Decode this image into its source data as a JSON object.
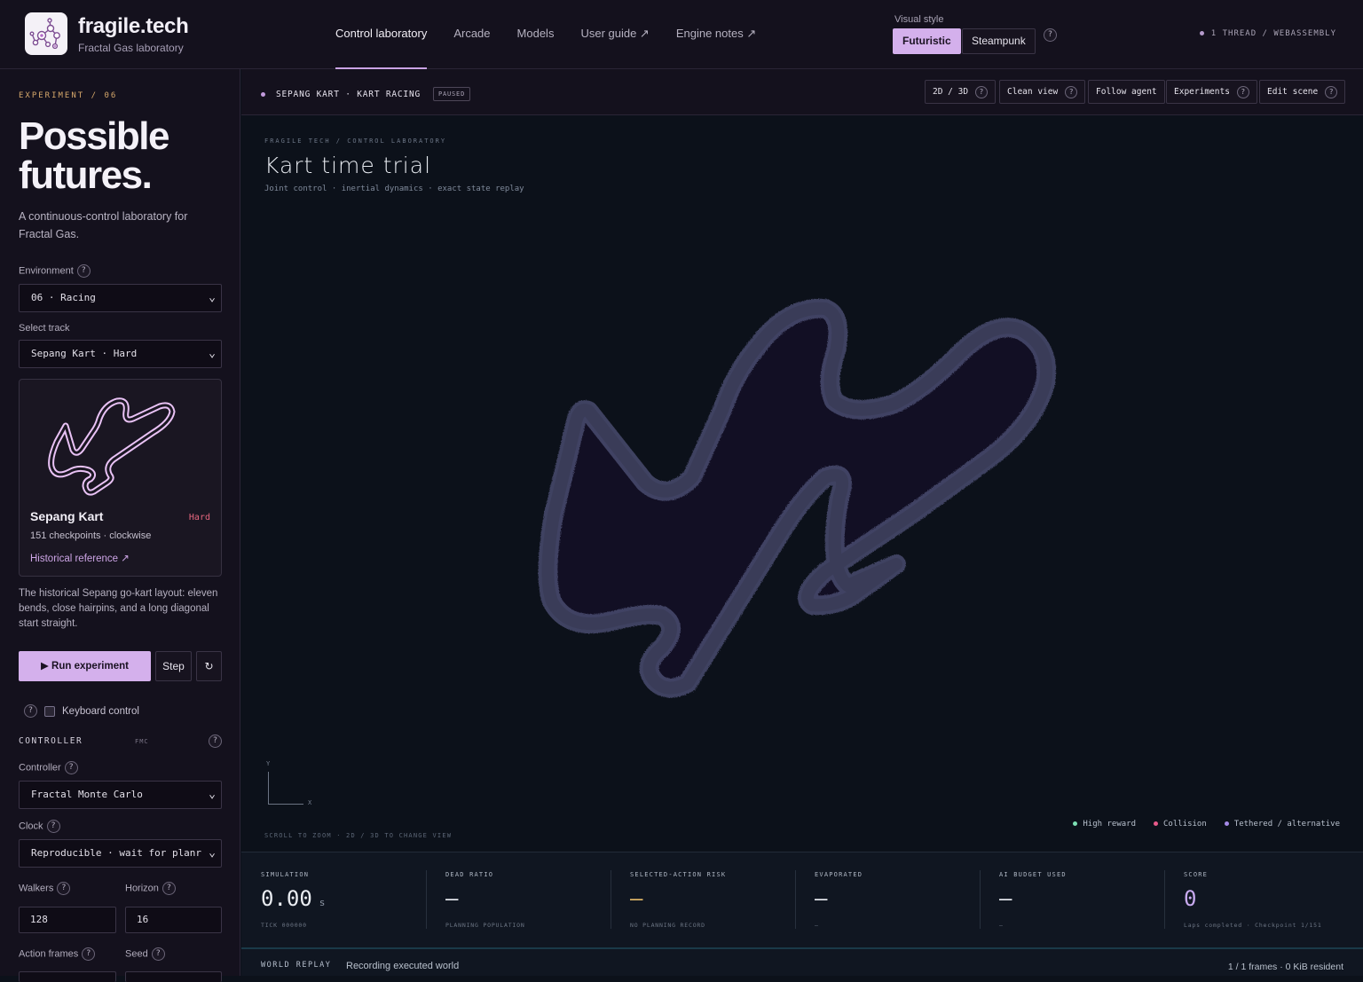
{
  "brand": {
    "title": "fragile.tech",
    "subtitle": "Fractal Gas laboratory"
  },
  "nav": [
    {
      "label": "Control laboratory",
      "active": true
    },
    {
      "label": "Arcade"
    },
    {
      "label": "Models"
    },
    {
      "label": "User guide ↗"
    },
    {
      "label": "Engine notes ↗"
    }
  ],
  "visual_style": {
    "label": "Visual style",
    "options": [
      "Futuristic",
      "Steampunk"
    ],
    "selected": "Futuristic",
    "help": "?"
  },
  "thread_info": "1 THREAD / WEBASSEMBLY",
  "sidebar": {
    "experiment_tag": "EXPERIMENT / 06",
    "hero": "Possible futures.",
    "hero_sub": "A continuous-control laboratory for Fractal Gas.",
    "environment_label": "Environment",
    "environment_value": "06 · Racing",
    "track_label": "Select track",
    "track_value": "Sepang Kart · Hard",
    "track_card": {
      "name": "Sepang Kart",
      "difficulty": "Hard",
      "meta": "151 checkpoints · clockwise",
      "link": "Historical reference ↗"
    },
    "track_description": "The historical Sepang go-kart layout: eleven bends, close hairpins, and a long diagonal start straight.",
    "run_label": "▶ Run experiment",
    "step_label": "Step",
    "reset_label": "↻",
    "keyboard_label": "Keyboard control",
    "controller_section": "CONTROLLER",
    "controller_tag": "FMC",
    "controller_label": "Controller",
    "controller_value": "Fractal Monte Carlo",
    "clock_label": "Clock",
    "clock_value": "Reproducible · wait for planr",
    "walkers_label": "Walkers",
    "walkers_value": "128",
    "horizon_label": "Horizon",
    "horizon_value": "16",
    "action_frames_label": "Action frames",
    "seed_label": "Seed",
    "help": "?"
  },
  "subbar": {
    "env_title": "SEPANG KART · KART RACING",
    "status": "PAUSED",
    "tools": [
      "2D / 3D",
      "Clean view",
      "Follow agent",
      "Experiments",
      "Edit scene"
    ],
    "help": "?"
  },
  "viewport": {
    "breadcrumb": "FRAGILE TECH / CONTROL LABORATORY",
    "title": "Kart time trial",
    "subtitle": "Joint control · inertial dynamics · exact state replay",
    "axis_x": "X",
    "axis_y": "Y",
    "hint": "SCROLL TO ZOOM · 2D / 3D TO CHANGE VIEW",
    "legend": [
      {
        "label": "High reward",
        "color": "#7de0b4"
      },
      {
        "label": "Collision",
        "color": "#e85a8a"
      },
      {
        "label": "Tethered / alternative",
        "color": "#a58ae8"
      }
    ]
  },
  "stats": [
    {
      "label": "SIMULATION",
      "value": "0.00",
      "unit": "s",
      "foot": "TICK 000000",
      "color": "#e9ecf1"
    },
    {
      "label": "DEAD RATIO",
      "value": "—",
      "unit": "",
      "foot": "PLANNING POPULATION",
      "color": "#e9ecf1"
    },
    {
      "label": "SELECTED-ACTION RISK",
      "value": "—",
      "unit": "",
      "foot": "NO PLANNING RECORD",
      "color": "#e3b969"
    },
    {
      "label": "EVAPORATED",
      "value": "—",
      "unit": "",
      "foot": "—",
      "color": "#e9ecf1"
    },
    {
      "label": "AI BUDGET USED",
      "value": "—",
      "unit": "",
      "foot": "—",
      "color": "#e9ecf1"
    },
    {
      "label": "SCORE",
      "value": "0",
      "unit": "",
      "foot": "Laps completed · Checkpoint 1/151",
      "color": "#c8aaf0"
    }
  ],
  "replay": {
    "label": "WORLD REPLAY",
    "text": "Recording executed world",
    "frames": "1 / 1 frames · 0 KiB resident"
  }
}
